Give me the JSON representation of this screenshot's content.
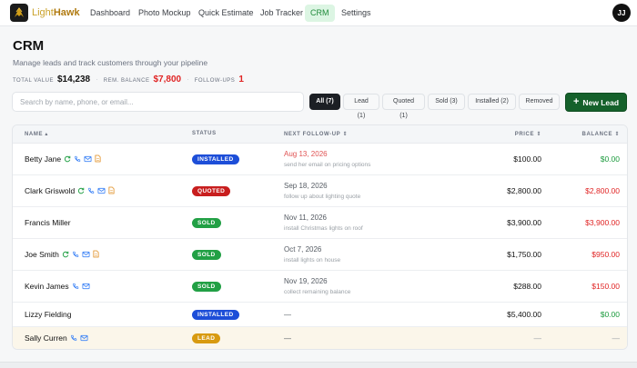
{
  "brand": {
    "name_part1": "Light",
    "name_part2": "Hawk"
  },
  "nav": {
    "items": [
      {
        "label": "Dashboard",
        "active": false
      },
      {
        "label": "Photo Mockup",
        "active": false
      },
      {
        "label": "Quick Estimate",
        "active": false
      },
      {
        "label": "Job Tracker",
        "active": false
      },
      {
        "label": "CRM",
        "active": true
      },
      {
        "label": "Settings",
        "active": false
      }
    ],
    "avatar_initials": "JJ"
  },
  "page": {
    "title": "CRM",
    "subtitle": "Manage leads and track customers through your pipeline"
  },
  "stats": {
    "total_value_label": "TOTAL VALUE",
    "total_value": "$14,238",
    "rem_balance_label": "REM. BALANCE",
    "rem_balance": "$7,800",
    "follow_ups_label": "FOLLOW-UPS",
    "follow_ups": "1"
  },
  "search": {
    "placeholder": "Search by name, phone, or email..."
  },
  "filters": [
    {
      "label": "All (7)",
      "active": true
    },
    {
      "label": "Lead (1)",
      "active": false
    },
    {
      "label": "Quoted (1)",
      "active": false
    },
    {
      "label": "Sold (3)",
      "active": false
    },
    {
      "label": "Installed (2)",
      "active": false
    },
    {
      "label": "Removed",
      "active": false
    }
  ],
  "new_lead_label": "New Lead",
  "table": {
    "headers": {
      "name": "NAME",
      "status": "STATUS",
      "followup": "NEXT FOLLOW-UP",
      "price": "PRICE",
      "balance": "BALANCE"
    },
    "rows": [
      {
        "name": "Betty Jane",
        "icons": [
          "refresh-icon",
          "phone-icon",
          "mail-icon",
          "document-icon"
        ],
        "status": "INSTALLED",
        "status_color": "#1d4ed8",
        "followup_date": "Aug 13, 2026",
        "followup_overdue": true,
        "followup_note": "send her email on pricing options",
        "price": "$100.00",
        "balance": "$0.00",
        "balance_color": "#1a9a3c"
      },
      {
        "name": "Clark Griswold",
        "icons": [
          "refresh-icon",
          "phone-icon",
          "mail-icon",
          "document-icon"
        ],
        "status": "QUOTED",
        "status_color": "#c81e1e",
        "followup_date": "Sep 18, 2026",
        "followup_overdue": false,
        "followup_note": "follow up about lighting quote",
        "price": "$2,800.00",
        "balance": "$2,800.00",
        "balance_color": "#e02424"
      },
      {
        "name": "Francis Miller",
        "icons": [],
        "status": "SOLD",
        "status_color": "#22a045",
        "followup_date": "Nov 11, 2026",
        "followup_overdue": false,
        "followup_note": "install Christmas lights on roof",
        "price": "$3,900.00",
        "balance": "$3,900.00",
        "balance_color": "#e02424"
      },
      {
        "name": "Joe Smith",
        "icons": [
          "refresh-icon",
          "phone-icon",
          "mail-icon",
          "document-icon"
        ],
        "status": "SOLD",
        "status_color": "#22a045",
        "followup_date": "Oct 7, 2026",
        "followup_overdue": false,
        "followup_note": "install lights on house",
        "price": "$1,750.00",
        "balance": "$950.00",
        "balance_color": "#e02424"
      },
      {
        "name": "Kevin James",
        "icons": [
          "phone-icon",
          "mail-icon"
        ],
        "status": "SOLD",
        "status_color": "#22a045",
        "followup_date": "Nov 19, 2026",
        "followup_overdue": false,
        "followup_note": "collect remaining balance",
        "price": "$288.00",
        "balance": "$150.00",
        "balance_color": "#e02424"
      },
      {
        "name": "Lizzy Fielding",
        "icons": [],
        "status": "INSTALLED",
        "status_color": "#1d4ed8",
        "followup_date": "—",
        "followup_overdue": false,
        "followup_note": "",
        "price": "$5,400.00",
        "balance": "$0.00",
        "balance_color": "#1a9a3c"
      },
      {
        "name": "Sally Curren",
        "icons": [
          "phone-icon",
          "mail-icon"
        ],
        "status": "LEAD",
        "status_color": "#d89a10",
        "followup_date": "—",
        "followup_overdue": false,
        "followup_note": "",
        "price": "—",
        "balance": "—",
        "balance_color": "#9aa0a6"
      }
    ]
  }
}
